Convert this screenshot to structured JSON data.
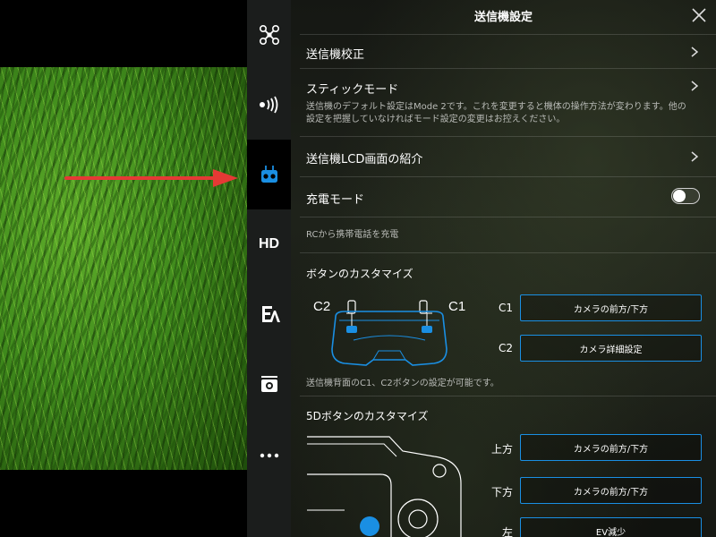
{
  "settings": {
    "title": "送信機設定",
    "rows": {
      "calibration": "送信機校正",
      "stick_mode": "スティックモード",
      "stick_mode_desc_1": "送信機のデフォルト設定はMode 2です。これを変更すると機体の操作方法が変わります。他の",
      "stick_mode_desc_2": "設定を把握していなければモード設定の変更はお控えください。",
      "lcd_intro": "送信機LCD画面の紹介",
      "charge_mode": "充電モード",
      "charge_desc": "RCから携帯電話を充電",
      "button_custom": "ボタンのカスタマイズ",
      "button_desc": "送信機背面のC1、C2ボタンの設定が可能です。",
      "fived_custom": "5Dボタンのカスタマイズ"
    },
    "charge_mode_on": false,
    "c_buttons": {
      "c1_label": "C1",
      "c1_value": "カメラの前方/下方",
      "c2_label": "C2",
      "c2_value": "カメラ詳細設定",
      "diagram_c1": "C1",
      "diagram_c2": "C2"
    },
    "fived_buttons": {
      "up_label": "上方",
      "up_value": "カメラの前方/下方",
      "down_label": "下方",
      "down_value": "カメラの前方/下方",
      "left_label": "左",
      "left_value": "EV減少"
    }
  },
  "sidebar": {
    "items": [
      {
        "icon": "drone-icon"
      },
      {
        "icon": "signal-icon"
      },
      {
        "icon": "remote-controller-icon",
        "active": true
      },
      {
        "icon": "hd-icon",
        "label": "HD"
      },
      {
        "icon": "aircraft-settings-icon"
      },
      {
        "icon": "camera-icon"
      },
      {
        "icon": "more-icon"
      }
    ]
  },
  "colors": {
    "accent": "#1a8fe3",
    "arrow": "#e53935",
    "sidebar": "#1b1d1c"
  }
}
